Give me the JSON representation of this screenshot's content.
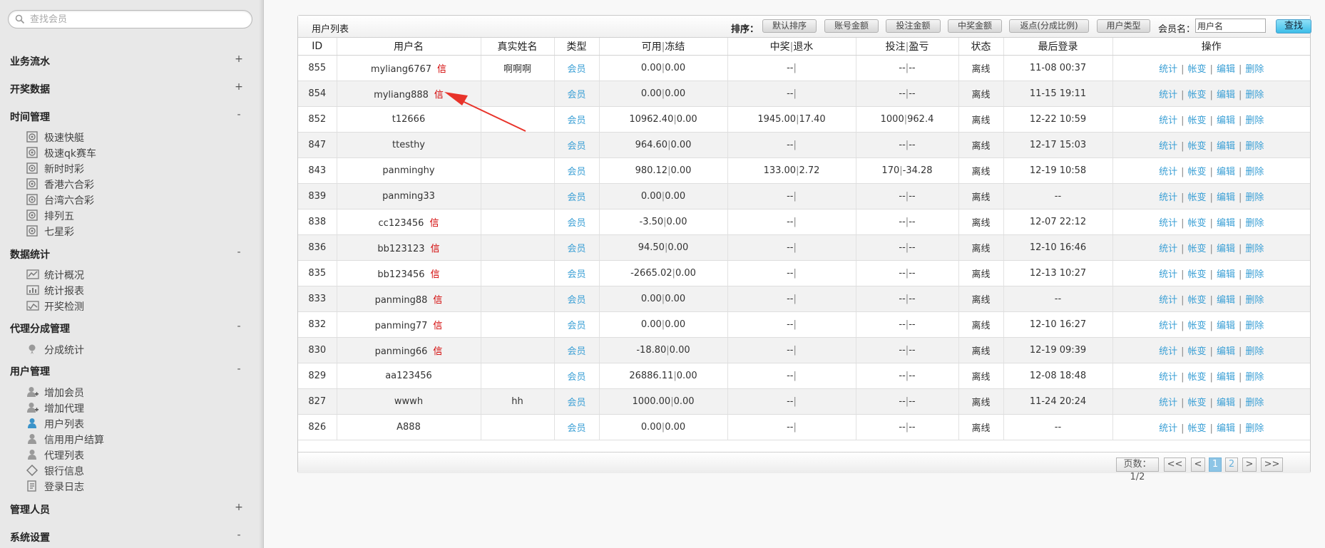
{
  "sidebar": {
    "search_placeholder": "查找会员",
    "sections": [
      {
        "title": "业务流水",
        "toggle": "+"
      },
      {
        "title": "开奖数据",
        "toggle": "+"
      },
      {
        "title": "时间管理",
        "toggle": "-"
      },
      {
        "title": "数据统计",
        "toggle": "-"
      },
      {
        "title": "代理分成管理",
        "toggle": "-"
      },
      {
        "title": "用户管理",
        "toggle": "-"
      },
      {
        "title": "管理人员",
        "toggle": "+"
      },
      {
        "title": "系统设置",
        "toggle": "-"
      }
    ],
    "time_items": [
      {
        "label": "极速快艇",
        "icon": "target-icon"
      },
      {
        "label": "极速qk赛车",
        "icon": "target-icon"
      },
      {
        "label": "新时时彩",
        "icon": "target-icon"
      },
      {
        "label": "香港六合彩",
        "icon": "target-icon"
      },
      {
        "label": "台湾六合彩",
        "icon": "target-icon"
      },
      {
        "label": "排列五",
        "icon": "target-icon"
      },
      {
        "label": "七星彩",
        "icon": "target-icon"
      }
    ],
    "stats_items": [
      {
        "label": "统计概况",
        "icon": "chart-icon"
      },
      {
        "label": "统计报表",
        "icon": "report-icon"
      },
      {
        "label": "开奖检测",
        "icon": "check-icon"
      }
    ],
    "agent_items": [
      {
        "label": "分成统计",
        "icon": "pin-icon"
      }
    ],
    "user_items": [
      {
        "label": "增加会员",
        "icon": "user-add-icon"
      },
      {
        "label": "增加代理",
        "icon": "user-add-icon"
      },
      {
        "label": "用户列表",
        "icon": "user-icon"
      },
      {
        "label": "信用用户结算",
        "icon": "user-icon"
      },
      {
        "label": "代理列表",
        "icon": "user-icon"
      },
      {
        "label": "银行信息",
        "icon": "diamond-icon"
      },
      {
        "label": "登录日志",
        "icon": "log-icon"
      }
    ]
  },
  "panel": {
    "title": "用户列表",
    "sort_label": "排序：",
    "sort_buttons": [
      "默认排序",
      "账号金额",
      "投注金额",
      "中奖金额",
      "返点(分成比例)",
      "用户类型"
    ],
    "member_label": "会员名：",
    "member_value": "用户名",
    "find_label": "查找"
  },
  "table": {
    "headers": [
      "ID",
      "用户名",
      "真实姓名",
      "类型",
      "可用|冻结",
      "中奖|退水",
      "投注|盈亏",
      "状态",
      "最后登录",
      "操作"
    ],
    "header_parts": {
      "avail_a": "可用",
      "avail_b": "冻结",
      "win_a": "中奖",
      "win_b": "退水",
      "bet_a": "投注",
      "bet_b": "盈亏",
      "pipe": "|"
    },
    "credit_tag": "信",
    "ops": [
      "统计",
      "帐变",
      "编辑",
      "删除"
    ],
    "rows": [
      {
        "id": "855",
        "user": "myliang6767",
        "credit": true,
        "real": "啊啊啊",
        "type": "会员",
        "avail": "0.00",
        "frozen": "0.00",
        "win": "--",
        "rebate": "",
        "bet": "--",
        "pl": "--",
        "status": "离线",
        "last": "11-08 00:37"
      },
      {
        "id": "854",
        "user": "myliang888",
        "credit": true,
        "real": "",
        "type": "会员",
        "avail": "0.00",
        "frozen": "0.00",
        "win": "--",
        "rebate": "",
        "bet": "--",
        "pl": "--",
        "status": "离线",
        "last": "11-15 19:11"
      },
      {
        "id": "852",
        "user": "t12666",
        "credit": false,
        "real": "",
        "type": "会员",
        "avail": "10962.40",
        "frozen": "0.00",
        "win": "1945.00",
        "rebate": "17.40",
        "bet": "1000",
        "pl": "962.4",
        "status": "离线",
        "last": "12-22 10:59"
      },
      {
        "id": "847",
        "user": "ttesthy",
        "credit": false,
        "real": "",
        "type": "会员",
        "avail": "964.60",
        "frozen": "0.00",
        "win": "--",
        "rebate": "",
        "bet": "--",
        "pl": "--",
        "status": "离线",
        "last": "12-17 15:03"
      },
      {
        "id": "843",
        "user": "panminghy",
        "credit": false,
        "real": "",
        "type": "会员",
        "avail": "980.12",
        "frozen": "0.00",
        "win": "133.00",
        "rebate": "2.72",
        "bet": "170",
        "pl": "-34.28",
        "status": "离线",
        "last": "12-19 10:58"
      },
      {
        "id": "839",
        "user": "panming33",
        "credit": false,
        "real": "",
        "type": "会员",
        "avail": "0.00",
        "frozen": "0.00",
        "win": "--",
        "rebate": "",
        "bet": "--",
        "pl": "--",
        "status": "离线",
        "last": "--"
      },
      {
        "id": "838",
        "user": "cc123456",
        "credit": true,
        "real": "",
        "type": "会员",
        "avail": "-3.50",
        "frozen": "0.00",
        "win": "--",
        "rebate": "",
        "bet": "--",
        "pl": "--",
        "status": "离线",
        "last": "12-07 22:12"
      },
      {
        "id": "836",
        "user": "bb123123",
        "credit": true,
        "real": "",
        "type": "会员",
        "avail": "94.50",
        "frozen": "0.00",
        "win": "--",
        "rebate": "",
        "bet": "--",
        "pl": "--",
        "status": "离线",
        "last": "12-10 16:46"
      },
      {
        "id": "835",
        "user": "bb123456",
        "credit": true,
        "real": "",
        "type": "会员",
        "avail": "-2665.02",
        "frozen": "0.00",
        "win": "--",
        "rebate": "",
        "bet": "--",
        "pl": "--",
        "status": "离线",
        "last": "12-13 10:27"
      },
      {
        "id": "833",
        "user": "panming88",
        "credit": true,
        "real": "",
        "type": "会员",
        "avail": "0.00",
        "frozen": "0.00",
        "win": "--",
        "rebate": "",
        "bet": "--",
        "pl": "--",
        "status": "离线",
        "last": "--"
      },
      {
        "id": "832",
        "user": "panming77",
        "credit": true,
        "real": "",
        "type": "会员",
        "avail": "0.00",
        "frozen": "0.00",
        "win": "--",
        "rebate": "",
        "bet": "--",
        "pl": "--",
        "status": "离线",
        "last": "12-10 16:27"
      },
      {
        "id": "830",
        "user": "panming66",
        "credit": true,
        "real": "",
        "type": "会员",
        "avail": "-18.80",
        "frozen": "0.00",
        "win": "--",
        "rebate": "",
        "bet": "--",
        "pl": "--",
        "status": "离线",
        "last": "12-19 09:39"
      },
      {
        "id": "829",
        "user": "aa123456",
        "credit": false,
        "real": "",
        "type": "会员",
        "avail": "26886.11",
        "frozen": "0.00",
        "win": "--",
        "rebate": "",
        "bet": "--",
        "pl": "--",
        "status": "离线",
        "last": "12-08 18:48"
      },
      {
        "id": "827",
        "user": "wwwh",
        "credit": false,
        "real": "hh",
        "type": "会员",
        "avail": "1000.00",
        "frozen": "0.00",
        "win": "--",
        "rebate": "",
        "bet": "--",
        "pl": "--",
        "status": "离线",
        "last": "11-24 20:24"
      },
      {
        "id": "826",
        "user": "A888",
        "credit": false,
        "real": "",
        "type": "会员",
        "avail": "0.00",
        "frozen": "0.00",
        "win": "--",
        "rebate": "",
        "bet": "--",
        "pl": "--",
        "status": "离线",
        "last": "--"
      }
    ]
  },
  "pager": {
    "info": "页数：1/2",
    "first": "<<",
    "prev": "<",
    "pages": [
      "1",
      "2"
    ],
    "current": "1",
    "next": ">",
    "last": ">>"
  },
  "colors": {
    "link": "#3a9fd5",
    "credit": "#d20000",
    "annotation_arrow": "#e8332a"
  }
}
